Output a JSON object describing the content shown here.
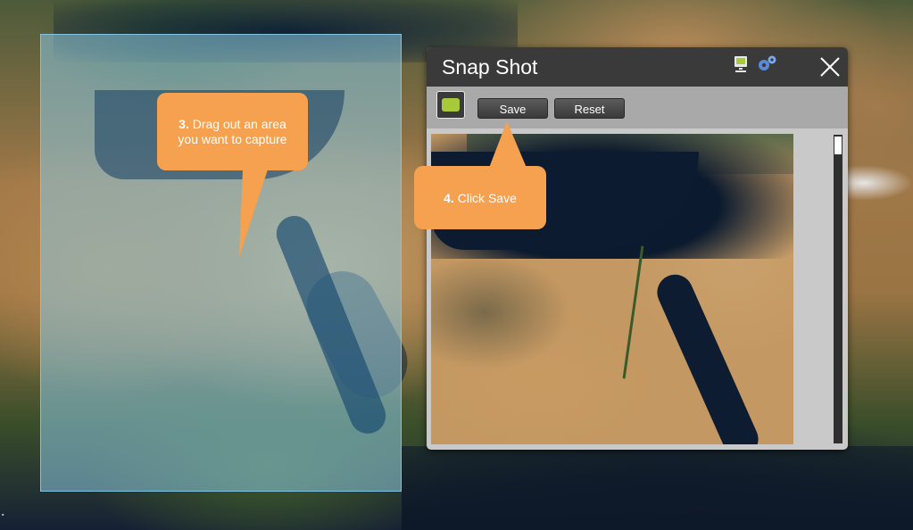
{
  "panel": {
    "title": "Snap Shot",
    "icons": [
      "monitor-icon",
      "gear-icon",
      "close-icon"
    ],
    "toolbar": {
      "save_label": "Save",
      "reset_label": "Reset"
    }
  },
  "callouts": {
    "step3": {
      "number": "3.",
      "text": "Drag out an area",
      "text2": "you want to capture"
    },
    "step4": {
      "number": "4.",
      "text": "Click Save"
    }
  },
  "colors": {
    "callout": "#f5a14f",
    "accent_green": "#a7c93a",
    "header": "#3a3a3a",
    "selection": "#8cc8e1"
  }
}
